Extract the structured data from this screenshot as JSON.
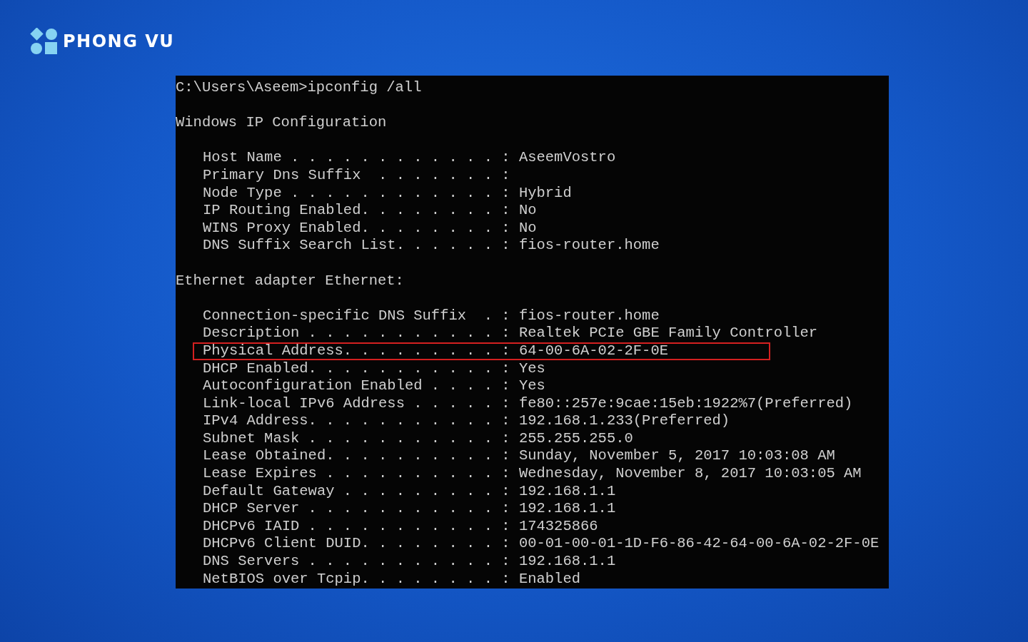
{
  "brand": {
    "name": "PHONG VU"
  },
  "console": {
    "prompt": "C:\\Users\\Aseem>ipconfig /all",
    "sections": [
      {
        "heading": "Windows IP Configuration",
        "rows": [
          {
            "label": "Host Name . . . . . . . . . . . . :",
            "value": "AseemVostro",
            "highlighted": false
          },
          {
            "label": "Primary Dns Suffix  . . . . . . . :",
            "highlighted": false
          },
          {
            "label": "Node Type . . . . . . . . . . . . :",
            "value": "Hybrid",
            "highlighted": false
          },
          {
            "label": "IP Routing Enabled. . . . . . . . :",
            "value": "No",
            "highlighted": false
          },
          {
            "label": "WINS Proxy Enabled. . . . . . . . :",
            "value": "No",
            "highlighted": false
          },
          {
            "label": "DNS Suffix Search List. . . . . . :",
            "value": "fios-router.home",
            "highlighted": false
          }
        ]
      },
      {
        "heading": "Ethernet adapter Ethernet:",
        "rows": [
          {
            "label": "Connection-specific DNS Suffix  . :",
            "value": "fios-router.home",
            "highlighted": false
          },
          {
            "label": "Description . . . . . . . . . . . :",
            "value": "Realtek PCIe GBE Family Controller",
            "highlighted": false
          },
          {
            "label": "Physical Address. . . . . . . . . :",
            "value": "64-00-6A-02-2F-0E",
            "highlighted": true
          },
          {
            "label": "DHCP Enabled. . . . . . . . . . . :",
            "value": "Yes",
            "highlighted": false
          },
          {
            "label": "Autoconfiguration Enabled . . . . :",
            "value": "Yes",
            "highlighted": false
          },
          {
            "label": "Link-local IPv6 Address . . . . . :",
            "value": "fe80::257e:9cae:15eb:1922%7(Preferred)",
            "highlighted": false
          },
          {
            "label": "IPv4 Address. . . . . . . . . . . :",
            "value": "192.168.1.233(Preferred)",
            "highlighted": false
          },
          {
            "label": "Subnet Mask . . . . . . . . . . . :",
            "value": "255.255.255.0",
            "highlighted": false
          },
          {
            "label": "Lease Obtained. . . . . . . . . . :",
            "value": "Sunday, November 5, 2017 10:03:08 AM",
            "highlighted": false
          },
          {
            "label": "Lease Expires . . . . . . . . . . :",
            "value": "Wednesday, November 8, 2017 10:03:05 AM",
            "highlighted": false
          },
          {
            "label": "Default Gateway . . . . . . . . . :",
            "value": "192.168.1.1",
            "highlighted": false
          },
          {
            "label": "DHCP Server . . . . . . . . . . . :",
            "value": "192.168.1.1",
            "highlighted": false
          },
          {
            "label": "DHCPv6 IAID . . . . . . . . . . . :",
            "value": "174325866",
            "highlighted": false
          },
          {
            "label": "DHCPv6 Client DUID. . . . . . . . :",
            "value": "00-01-00-01-1D-F6-86-42-64-00-6A-02-2F-0E",
            "highlighted": false
          },
          {
            "label": "DNS Servers . . . . . . . . . . . :",
            "value": "192.168.1.1",
            "highlighted": false
          },
          {
            "label": "NetBIOS over Tcpip. . . . . . . . :",
            "value": "Enabled",
            "highlighted": false
          }
        ]
      }
    ]
  }
}
